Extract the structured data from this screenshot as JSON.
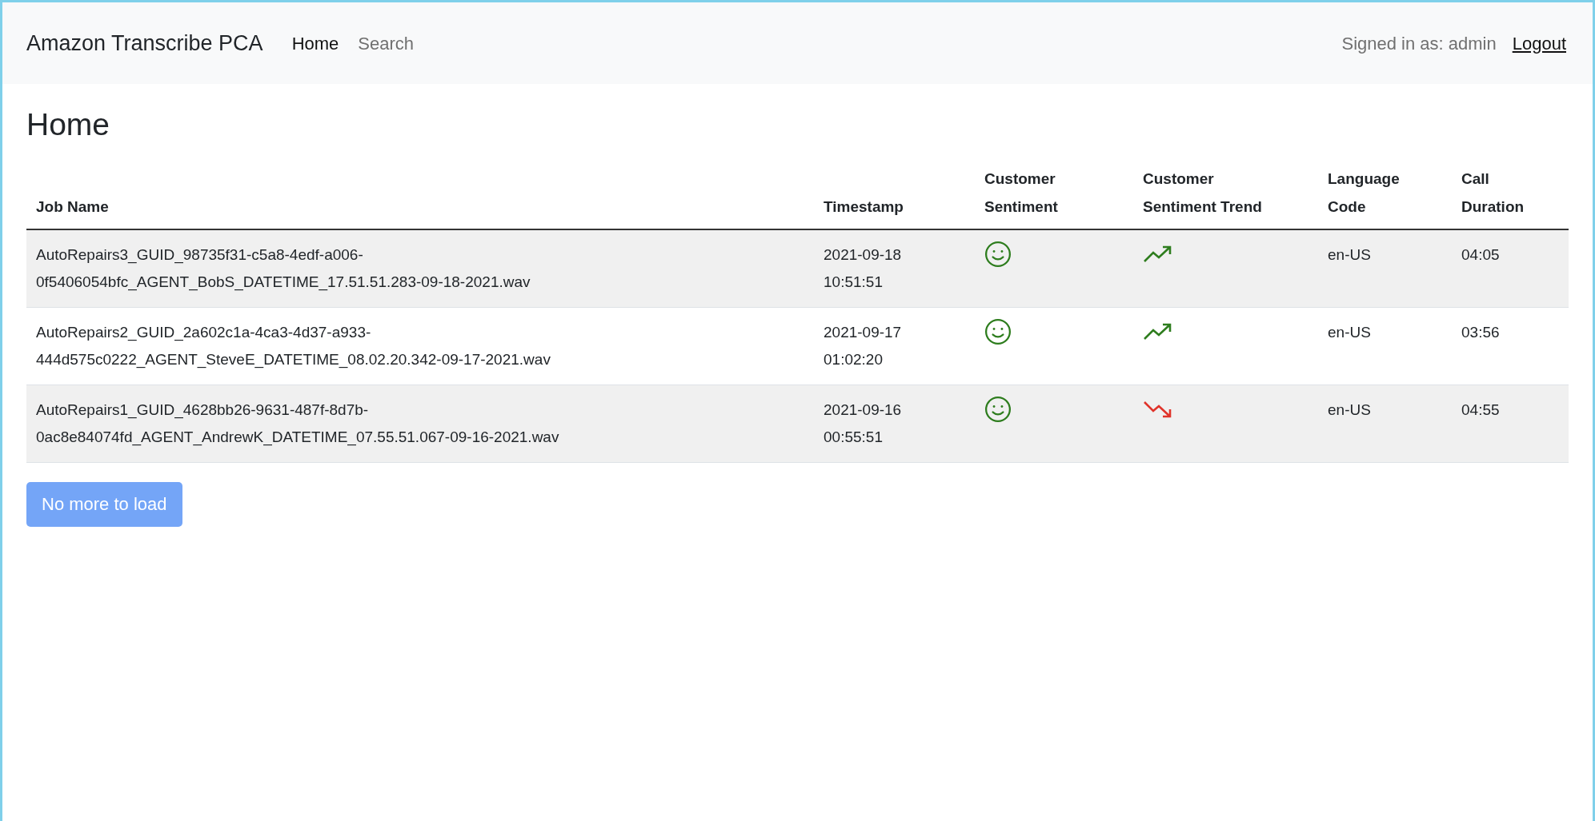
{
  "navbar": {
    "brand": "Amazon Transcribe PCA",
    "links": [
      {
        "label": "Home",
        "selected": true
      },
      {
        "label": "Search",
        "selected": false
      }
    ],
    "signed_in": "Signed in as: admin",
    "logout": "Logout"
  },
  "heading": "Home",
  "table": {
    "columns": [
      "Job Name",
      "Timestamp",
      "Customer Sentiment",
      "Customer Sentiment Trend",
      "Language Code",
      "Call Duration"
    ],
    "rows": [
      {
        "job_name": "AutoRepairs3_GUID_98735f31-c5a8-4edf-a006-0f5406054bfc_AGENT_BobS_DATETIME_17.51.51.283-09-18-2021.wav",
        "timestamp_date": "2021-09-18",
        "timestamp_time": "10:51:51",
        "sentiment": {
          "kind": "positive"
        },
        "trend": {
          "kind": "up"
        },
        "language": "en-US",
        "duration": "04:05"
      },
      {
        "job_name": "AutoRepairs2_GUID_2a602c1a-4ca3-4d37-a933-444d575c0222_AGENT_SteveE_DATETIME_08.02.20.342-09-17-2021.wav",
        "timestamp_date": "2021-09-17",
        "timestamp_time": "01:02:20",
        "sentiment": {
          "kind": "positive"
        },
        "trend": {
          "kind": "up"
        },
        "language": "en-US",
        "duration": "03:56"
      },
      {
        "job_name": "AutoRepairs1_GUID_4628bb26-9631-487f-8d7b-0ac8e84074fd_AGENT_AndrewK_DATETIME_07.55.51.067-09-16-2021.wav",
        "timestamp_date": "2021-09-16",
        "timestamp_time": "00:55:51",
        "sentiment": {
          "kind": "positive"
        },
        "trend": {
          "kind": "down"
        },
        "language": "en-US",
        "duration": "04:55"
      }
    ]
  },
  "load_button": {
    "label": "No more to load",
    "disabled": true
  }
}
